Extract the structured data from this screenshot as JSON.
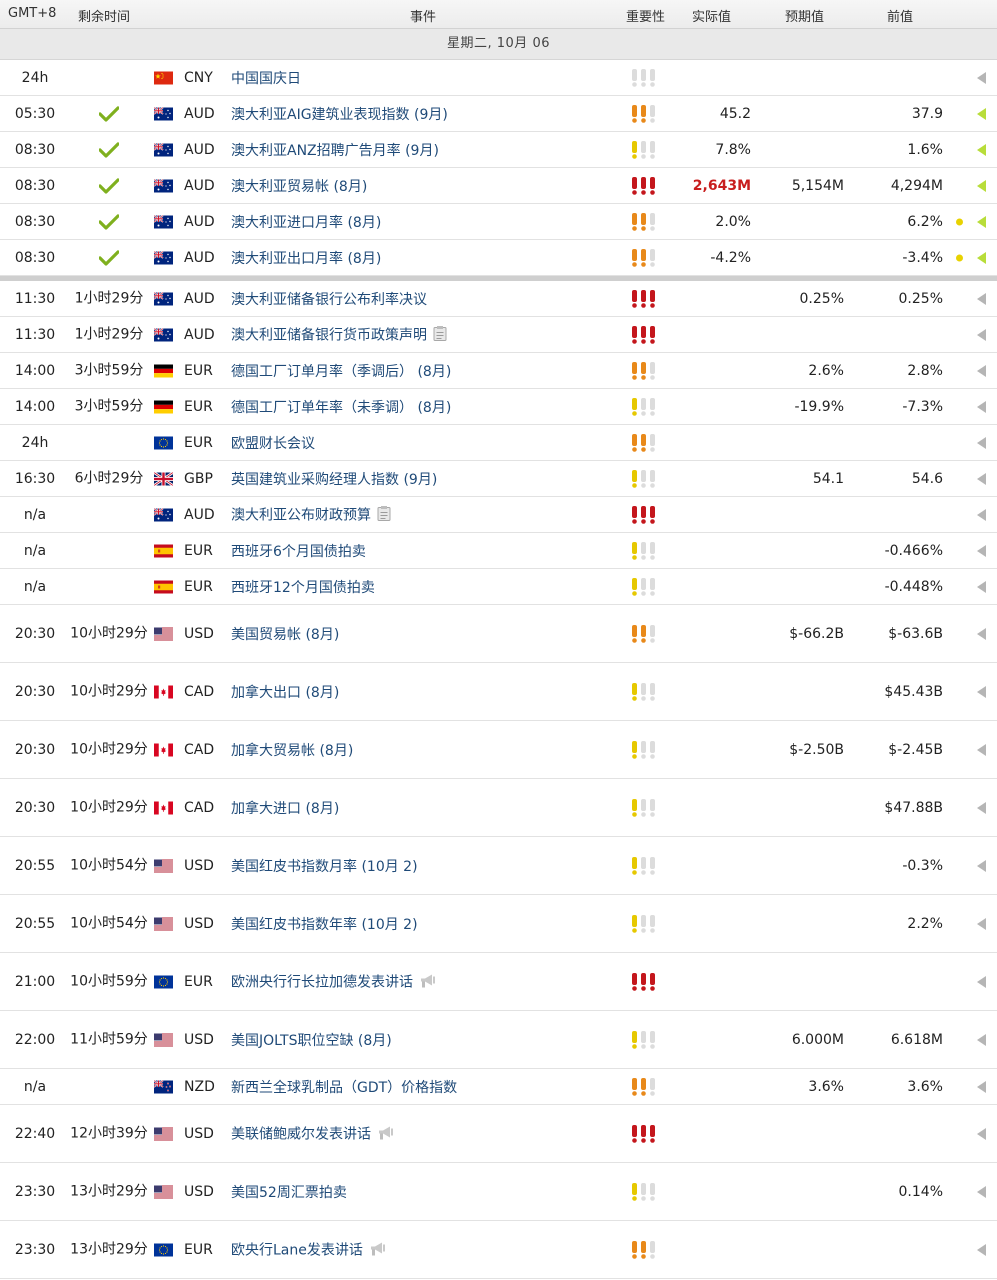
{
  "header": {
    "timezone": "GMT+8",
    "remaining": "剩余时间",
    "event": "事件",
    "importance": "重要性",
    "actual": "实际值",
    "forecast": "预期值",
    "previous": "前值"
  },
  "date_label": "星期二, 10月 06",
  "colors": {
    "low": "#e6c800",
    "medium": "#e8891a",
    "high": "#c4161c",
    "empty": "#dcdcdc",
    "check": "#7fb01e",
    "tri_green": "#b8dd3a",
    "tri_grey": "#b5b5b5"
  },
  "rows": [
    {
      "time": "24h",
      "rem": "",
      "check": false,
      "flag": "cn",
      "cur": "CNY",
      "event": "中国国庆日",
      "icon": "",
      "imp": "none",
      "actual": "",
      "actual_red": false,
      "forecast": "",
      "previous": "",
      "dot": false,
      "tri": "grey",
      "tall": false
    },
    {
      "time": "05:30",
      "rem": "",
      "check": true,
      "flag": "au",
      "cur": "AUD",
      "event": "澳大利亚AIG建筑业表现指数 (9月)",
      "icon": "",
      "imp": "medium",
      "actual": "45.2",
      "actual_red": false,
      "forecast": "",
      "previous": "37.9",
      "dot": false,
      "tri": "green",
      "tall": false
    },
    {
      "time": "08:30",
      "rem": "",
      "check": true,
      "flag": "au",
      "cur": "AUD",
      "event": "澳大利亚ANZ招聘广告月率 (9月)",
      "icon": "",
      "imp": "low",
      "actual": "7.8%",
      "actual_red": false,
      "forecast": "",
      "previous": "1.6%",
      "dot": false,
      "tri": "green",
      "tall": false
    },
    {
      "time": "08:30",
      "rem": "",
      "check": true,
      "flag": "au",
      "cur": "AUD",
      "event": "澳大利亚贸易帐 (8月)",
      "icon": "",
      "imp": "high",
      "actual": "2,643M",
      "actual_red": true,
      "forecast": "5,154M",
      "previous": "4,294M",
      "dot": false,
      "tri": "green",
      "tall": false
    },
    {
      "time": "08:30",
      "rem": "",
      "check": true,
      "flag": "au",
      "cur": "AUD",
      "event": "澳大利亚进口月率 (8月)",
      "icon": "",
      "imp": "medium",
      "actual": "2.0%",
      "actual_red": false,
      "forecast": "",
      "previous": "6.2%",
      "dot": true,
      "tri": "green",
      "tall": false
    },
    {
      "time": "08:30",
      "rem": "",
      "check": true,
      "flag": "au",
      "cur": "AUD",
      "event": "澳大利亚出口月率 (8月)",
      "icon": "",
      "imp": "medium",
      "actual": "-4.2%",
      "actual_red": false,
      "forecast": "",
      "previous": "-3.4%",
      "dot": true,
      "tri": "green",
      "tall": false
    },
    {
      "sep": true
    },
    {
      "time": "11:30",
      "rem": "1小时29分",
      "check": false,
      "flag": "au",
      "cur": "AUD",
      "event": "澳大利亚储备银行公布利率决议",
      "icon": "",
      "imp": "high",
      "actual": "",
      "actual_red": false,
      "forecast": "0.25%",
      "previous": "0.25%",
      "dot": false,
      "tri": "grey",
      "tall": false
    },
    {
      "time": "11:30",
      "rem": "1小时29分",
      "check": false,
      "flag": "au",
      "cur": "AUD",
      "event": "澳大利亚储备银行货币政策声明",
      "icon": "note",
      "imp": "high",
      "actual": "",
      "actual_red": false,
      "forecast": "",
      "previous": "",
      "dot": false,
      "tri": "grey",
      "tall": false
    },
    {
      "time": "14:00",
      "rem": "3小时59分",
      "check": false,
      "flag": "de",
      "cur": "EUR",
      "event": "德国工厂订单月率（季调后） (8月)",
      "icon": "",
      "imp": "medium",
      "actual": "",
      "actual_red": false,
      "forecast": "2.6%",
      "previous": "2.8%",
      "dot": false,
      "tri": "grey",
      "tall": false
    },
    {
      "time": "14:00",
      "rem": "3小时59分",
      "check": false,
      "flag": "de",
      "cur": "EUR",
      "event": "德国工厂订单年率（未季调） (8月)",
      "icon": "",
      "imp": "low",
      "actual": "",
      "actual_red": false,
      "forecast": "-19.9%",
      "previous": "-7.3%",
      "dot": false,
      "tri": "grey",
      "tall": false
    },
    {
      "time": "24h",
      "rem": "",
      "check": false,
      "flag": "eu",
      "cur": "EUR",
      "event": "欧盟财长会议",
      "icon": "",
      "imp": "medium",
      "actual": "",
      "actual_red": false,
      "forecast": "",
      "previous": "",
      "dot": false,
      "tri": "grey",
      "tall": false
    },
    {
      "time": "16:30",
      "rem": "6小时29分",
      "check": false,
      "flag": "gb",
      "cur": "GBP",
      "event": "英国建筑业采购经理人指数 (9月)",
      "icon": "",
      "imp": "low",
      "actual": "",
      "actual_red": false,
      "forecast": "54.1",
      "previous": "54.6",
      "dot": false,
      "tri": "grey",
      "tall": false
    },
    {
      "time": "n/a",
      "rem": "",
      "check": false,
      "flag": "au",
      "cur": "AUD",
      "event": "澳大利亚公布财政预算",
      "icon": "note",
      "imp": "high",
      "actual": "",
      "actual_red": false,
      "forecast": "",
      "previous": "",
      "dot": false,
      "tri": "grey",
      "tall": false
    },
    {
      "time": "n/a",
      "rem": "",
      "check": false,
      "flag": "es",
      "cur": "EUR",
      "event": "西班牙6个月国债拍卖",
      "icon": "",
      "imp": "low",
      "actual": "",
      "actual_red": false,
      "forecast": "",
      "previous": "-0.466%",
      "dot": false,
      "tri": "grey",
      "tall": false
    },
    {
      "time": "n/a",
      "rem": "",
      "check": false,
      "flag": "es",
      "cur": "EUR",
      "event": "西班牙12个月国债拍卖",
      "icon": "",
      "imp": "low",
      "actual": "",
      "actual_red": false,
      "forecast": "",
      "previous": "-0.448%",
      "dot": false,
      "tri": "grey",
      "tall": false
    },
    {
      "time": "20:30",
      "rem": "10小时29分",
      "check": false,
      "flag": "us",
      "cur": "USD",
      "event": "美国贸易帐 (8月)",
      "icon": "",
      "imp": "medium",
      "actual": "",
      "actual_red": false,
      "forecast": "$-66.2B",
      "previous": "$-63.6B",
      "dot": false,
      "tri": "grey",
      "tall": true
    },
    {
      "time": "20:30",
      "rem": "10小时29分",
      "check": false,
      "flag": "ca",
      "cur": "CAD",
      "event": "加拿大出口 (8月)",
      "icon": "",
      "imp": "low",
      "actual": "",
      "actual_red": false,
      "forecast": "",
      "previous": "$45.43B",
      "dot": false,
      "tri": "grey",
      "tall": true
    },
    {
      "time": "20:30",
      "rem": "10小时29分",
      "check": false,
      "flag": "ca",
      "cur": "CAD",
      "event": "加拿大贸易帐 (8月)",
      "icon": "",
      "imp": "low",
      "actual": "",
      "actual_red": false,
      "forecast": "$-2.50B",
      "previous": "$-2.45B",
      "dot": false,
      "tri": "grey",
      "tall": true
    },
    {
      "time": "20:30",
      "rem": "10小时29分",
      "check": false,
      "flag": "ca",
      "cur": "CAD",
      "event": "加拿大进口 (8月)",
      "icon": "",
      "imp": "low",
      "actual": "",
      "actual_red": false,
      "forecast": "",
      "previous": "$47.88B",
      "dot": false,
      "tri": "grey",
      "tall": true
    },
    {
      "time": "20:55",
      "rem": "10小时54分",
      "check": false,
      "flag": "us",
      "cur": "USD",
      "event": "美国红皮书指数月率 (10月 2)",
      "icon": "",
      "imp": "low",
      "actual": "",
      "actual_red": false,
      "forecast": "",
      "previous": "-0.3%",
      "dot": false,
      "tri": "grey",
      "tall": true
    },
    {
      "time": "20:55",
      "rem": "10小时54分",
      "check": false,
      "flag": "us",
      "cur": "USD",
      "event": "美国红皮书指数年率 (10月 2)",
      "icon": "",
      "imp": "low",
      "actual": "",
      "actual_red": false,
      "forecast": "",
      "previous": "2.2%",
      "dot": false,
      "tri": "grey",
      "tall": true
    },
    {
      "time": "21:00",
      "rem": "10小时59分",
      "check": false,
      "flag": "eu",
      "cur": "EUR",
      "event": "欧洲央行行长拉加德发表讲话",
      "icon": "speak",
      "imp": "high",
      "actual": "",
      "actual_red": false,
      "forecast": "",
      "previous": "",
      "dot": false,
      "tri": "grey",
      "tall": true
    },
    {
      "time": "22:00",
      "rem": "11小时59分",
      "check": false,
      "flag": "us",
      "cur": "USD",
      "event": "美国JOLTS职位空缺 (8月)",
      "icon": "",
      "imp": "low",
      "actual": "",
      "actual_red": false,
      "forecast": "6.000M",
      "previous": "6.618M",
      "dot": false,
      "tri": "grey",
      "tall": true
    },
    {
      "time": "n/a",
      "rem": "",
      "check": false,
      "flag": "nz",
      "cur": "NZD",
      "event": "新西兰全球乳制品（GDT）价格指数",
      "icon": "",
      "imp": "medium",
      "actual": "",
      "actual_red": false,
      "forecast": "3.6%",
      "previous": "3.6%",
      "dot": false,
      "tri": "grey",
      "tall": false
    },
    {
      "time": "22:40",
      "rem": "12小时39分",
      "check": false,
      "flag": "us",
      "cur": "USD",
      "event": "美联储鲍威尔发表讲话",
      "icon": "speak",
      "imp": "high",
      "actual": "",
      "actual_red": false,
      "forecast": "",
      "previous": "",
      "dot": false,
      "tri": "grey",
      "tall": true
    },
    {
      "time": "23:30",
      "rem": "13小时29分",
      "check": false,
      "flag": "us",
      "cur": "USD",
      "event": "美国52周汇票拍卖",
      "icon": "",
      "imp": "low",
      "actual": "",
      "actual_red": false,
      "forecast": "",
      "previous": "0.14%",
      "dot": false,
      "tri": "grey",
      "tall": true
    },
    {
      "time": "23:30",
      "rem": "13小时29分",
      "check": false,
      "flag": "eu",
      "cur": "EUR",
      "event": "欧央行Lane发表讲话",
      "icon": "speak",
      "imp": "medium",
      "actual": "",
      "actual_red": false,
      "forecast": "",
      "previous": "",
      "dot": false,
      "tri": "grey",
      "tall": true
    }
  ]
}
